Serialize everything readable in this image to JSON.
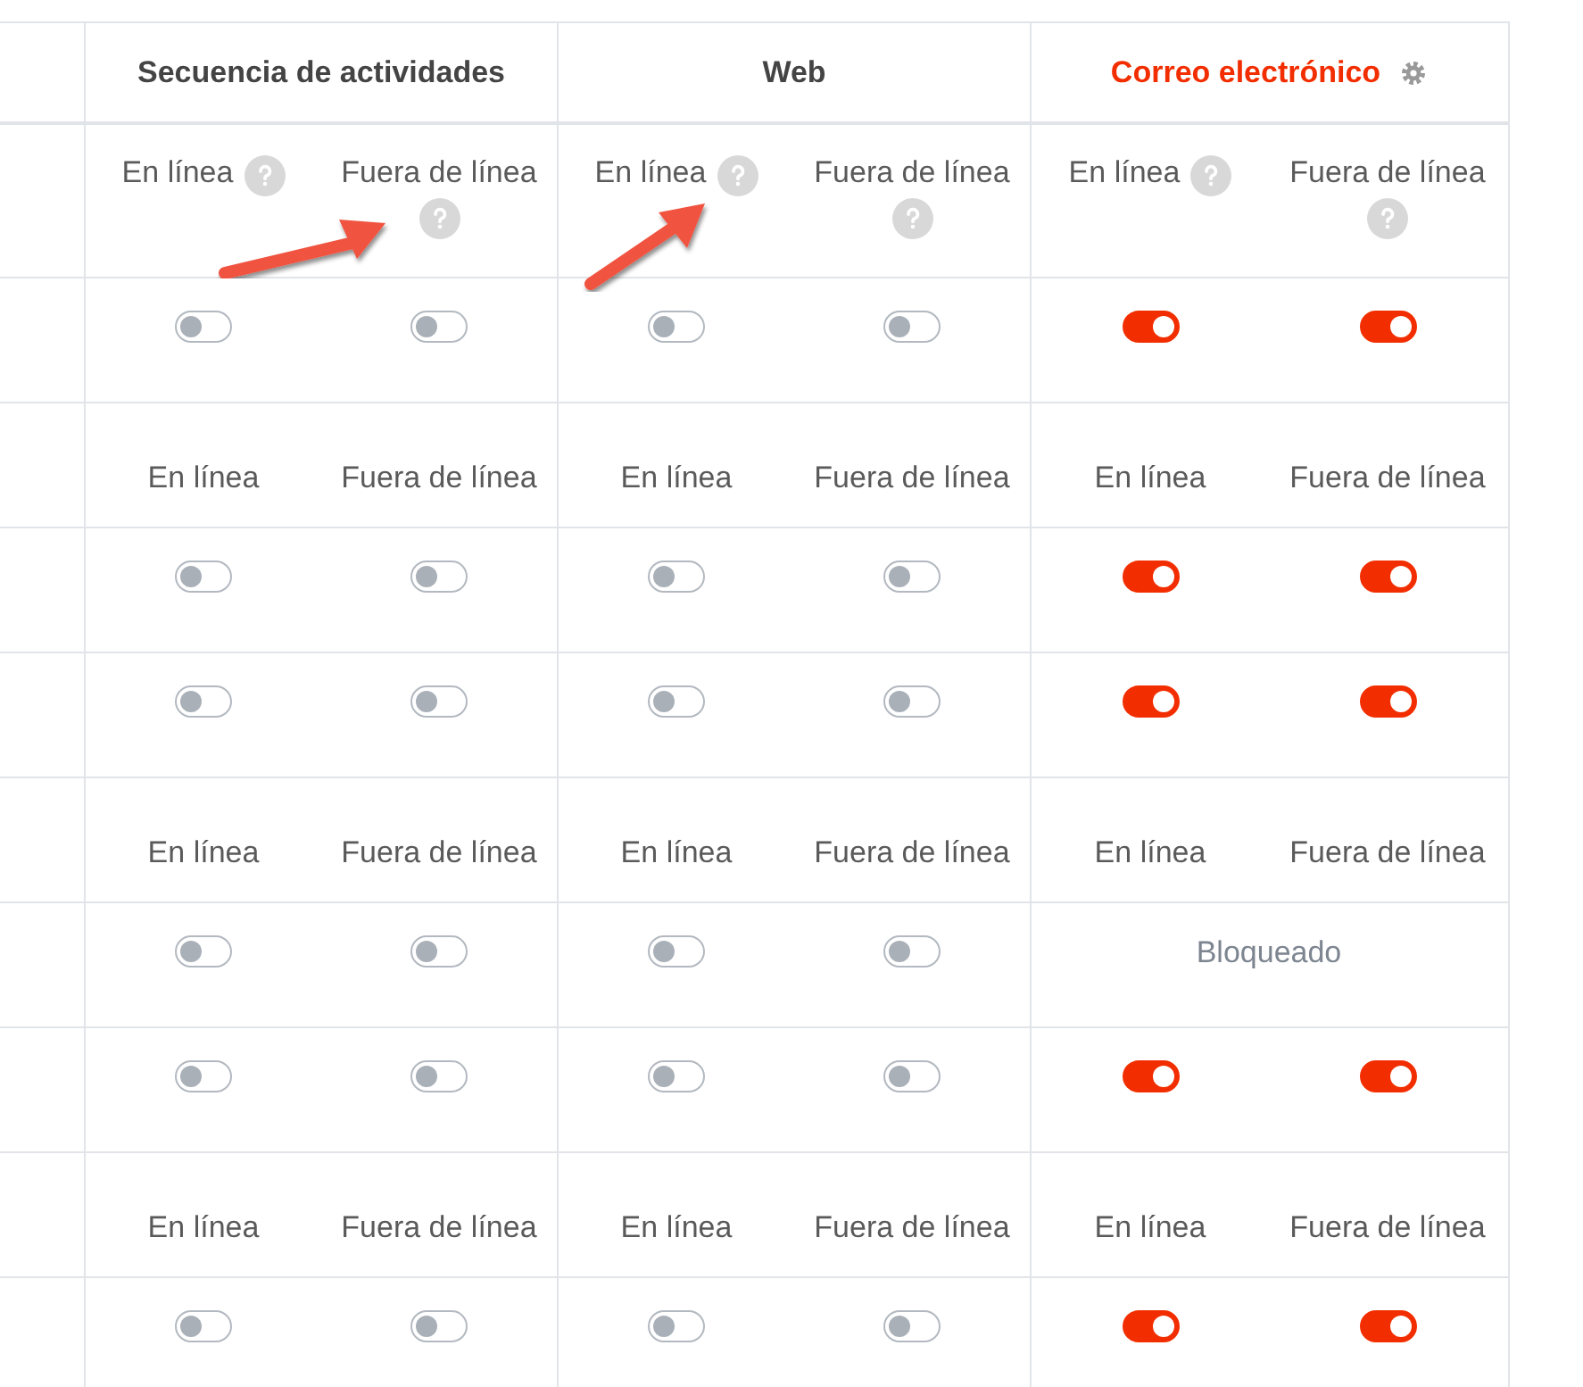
{
  "columns": [
    {
      "title": "Secuencia de actividades",
      "highlighted": false,
      "settings": false
    },
    {
      "title": "Web",
      "highlighted": false,
      "settings": false
    },
    {
      "title": "Correo electrónico",
      "highlighted": true,
      "settings": true
    }
  ],
  "rows": [
    {
      "kind": "labels",
      "groups": [
        [
          {
            "label": "En línea",
            "help": true
          },
          {
            "label": "Fuera de línea",
            "help": true
          }
        ],
        [
          {
            "label": "En línea",
            "help": true
          },
          {
            "label": "Fuera de línea",
            "help": true
          }
        ],
        [
          {
            "label": "En línea",
            "help": true
          },
          {
            "label": "Fuera de línea",
            "help": true
          }
        ]
      ]
    },
    {
      "kind": "toggles",
      "groups": [
        {
          "kind": "switches",
          "switches": [
            {
              "on": false
            },
            {
              "on": false
            }
          ]
        },
        {
          "kind": "switches",
          "switches": [
            {
              "on": false
            },
            {
              "on": false
            }
          ]
        },
        {
          "kind": "switches",
          "switches": [
            {
              "on": true
            },
            {
              "on": true
            }
          ]
        }
      ]
    },
    {
      "kind": "labels",
      "groups": [
        [
          {
            "label": "En línea"
          },
          {
            "label": "Fuera de línea"
          }
        ],
        [
          {
            "label": "En línea"
          },
          {
            "label": "Fuera de línea"
          }
        ],
        [
          {
            "label": "En línea"
          },
          {
            "label": "Fuera de línea"
          }
        ]
      ]
    },
    {
      "kind": "toggles",
      "groups": [
        {
          "kind": "switches",
          "switches": [
            {
              "on": false
            },
            {
              "on": false
            }
          ]
        },
        {
          "kind": "switches",
          "switches": [
            {
              "on": false
            },
            {
              "on": false
            }
          ]
        },
        {
          "kind": "switches",
          "switches": [
            {
              "on": true
            },
            {
              "on": true
            }
          ]
        }
      ]
    },
    {
      "kind": "toggles",
      "groups": [
        {
          "kind": "switches",
          "switches": [
            {
              "on": false
            },
            {
              "on": false
            }
          ]
        },
        {
          "kind": "switches",
          "switches": [
            {
              "on": false
            },
            {
              "on": false
            }
          ]
        },
        {
          "kind": "switches",
          "switches": [
            {
              "on": true
            },
            {
              "on": true
            }
          ]
        }
      ]
    },
    {
      "kind": "labels",
      "groups": [
        [
          {
            "label": "En línea"
          },
          {
            "label": "Fuera de línea"
          }
        ],
        [
          {
            "label": "En línea"
          },
          {
            "label": "Fuera de línea"
          }
        ],
        [
          {
            "label": "En línea"
          },
          {
            "label": "Fuera de línea"
          }
        ]
      ]
    },
    {
      "kind": "toggles",
      "groups": [
        {
          "kind": "switches",
          "switches": [
            {
              "on": false
            },
            {
              "on": false
            }
          ]
        },
        {
          "kind": "switches",
          "switches": [
            {
              "on": false
            },
            {
              "on": false
            }
          ]
        },
        {
          "kind": "blocked",
          "text": "Bloqueado"
        }
      ]
    },
    {
      "kind": "toggles",
      "groups": [
        {
          "kind": "switches",
          "switches": [
            {
              "on": false
            },
            {
              "on": false
            }
          ]
        },
        {
          "kind": "switches",
          "switches": [
            {
              "on": false
            },
            {
              "on": false
            }
          ]
        },
        {
          "kind": "switches",
          "switches": [
            {
              "on": true
            },
            {
              "on": true
            }
          ]
        }
      ]
    },
    {
      "kind": "labels",
      "groups": [
        [
          {
            "label": "En línea"
          },
          {
            "label": "Fuera de línea"
          }
        ],
        [
          {
            "label": "En línea"
          },
          {
            "label": "Fuera de línea"
          }
        ],
        [
          {
            "label": "En línea"
          },
          {
            "label": "Fuera de línea"
          }
        ]
      ]
    },
    {
      "kind": "toggles",
      "groups": [
        {
          "kind": "switches",
          "switches": [
            {
              "on": false
            },
            {
              "on": false
            }
          ]
        },
        {
          "kind": "switches",
          "switches": [
            {
              "on": false
            },
            {
              "on": false
            }
          ]
        },
        {
          "kind": "switches",
          "switches": [
            {
              "on": true
            },
            {
              "on": true
            }
          ]
        }
      ]
    }
  ]
}
